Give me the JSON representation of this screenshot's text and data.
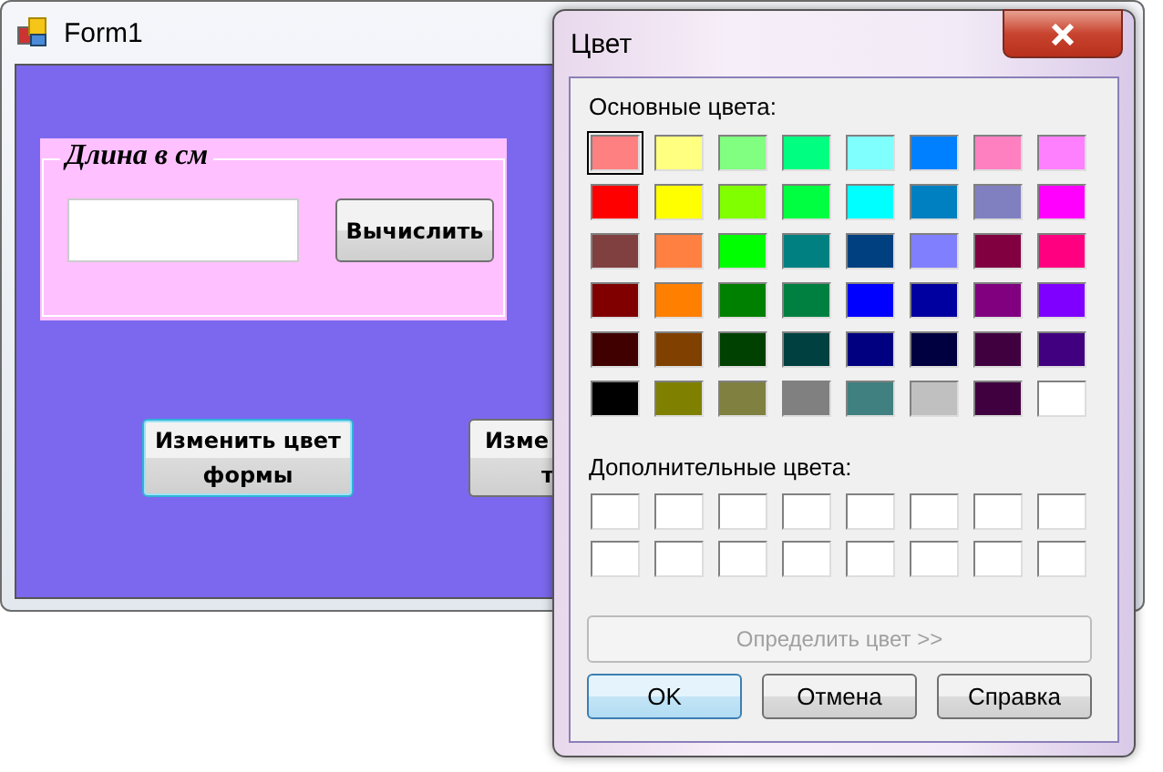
{
  "form_window": {
    "title": "Form1",
    "group": {
      "title": "Длина в см",
      "button": "Вычислить"
    },
    "buttons": [
      {
        "lines": [
          "Изменить цвет",
          "формы"
        ],
        "focused": true
      },
      {
        "lines": [
          "Изме",
          "т"
        ],
        "focused": false
      }
    ]
  },
  "color_dialog": {
    "title": "Цвет",
    "basic_label": "Основные цвета:",
    "basic_colors": [
      {
        "color": "#ff8080",
        "selected": true
      },
      {
        "color": "#ffff80",
        "selected": false
      },
      {
        "color": "#80ff80",
        "selected": false
      },
      {
        "color": "#00ff80",
        "selected": false
      },
      {
        "color": "#80ffff",
        "selected": false
      },
      {
        "color": "#0080ff",
        "selected": false
      },
      {
        "color": "#ff80c0",
        "selected": false
      },
      {
        "color": "#ff80ff",
        "selected": false
      },
      {
        "color": "#ff0000",
        "selected": false
      },
      {
        "color": "#ffff00",
        "selected": false
      },
      {
        "color": "#80ff00",
        "selected": false
      },
      {
        "color": "#00ff40",
        "selected": false
      },
      {
        "color": "#00ffff",
        "selected": false
      },
      {
        "color": "#0080c0",
        "selected": false
      },
      {
        "color": "#8080c0",
        "selected": false
      },
      {
        "color": "#ff00ff",
        "selected": false
      },
      {
        "color": "#804040",
        "selected": false
      },
      {
        "color": "#ff8040",
        "selected": false
      },
      {
        "color": "#00ff00",
        "selected": false
      },
      {
        "color": "#008080",
        "selected": false
      },
      {
        "color": "#004080",
        "selected": false
      },
      {
        "color": "#8080ff",
        "selected": false
      },
      {
        "color": "#800040",
        "selected": false
      },
      {
        "color": "#ff0080",
        "selected": false
      },
      {
        "color": "#800000",
        "selected": false
      },
      {
        "color": "#ff8000",
        "selected": false
      },
      {
        "color": "#008000",
        "selected": false
      },
      {
        "color": "#008040",
        "selected": false
      },
      {
        "color": "#0000ff",
        "selected": false
      },
      {
        "color": "#0000a0",
        "selected": false
      },
      {
        "color": "#800080",
        "selected": false
      },
      {
        "color": "#8000ff",
        "selected": false
      },
      {
        "color": "#400000",
        "selected": false
      },
      {
        "color": "#804000",
        "selected": false
      },
      {
        "color": "#004000",
        "selected": false
      },
      {
        "color": "#004040",
        "selected": false
      },
      {
        "color": "#000080",
        "selected": false
      },
      {
        "color": "#000040",
        "selected": false
      },
      {
        "color": "#400040",
        "selected": false
      },
      {
        "color": "#400080",
        "selected": false
      },
      {
        "color": "#000000",
        "selected": false
      },
      {
        "color": "#808000",
        "selected": false
      },
      {
        "color": "#808040",
        "selected": false
      },
      {
        "color": "#808080",
        "selected": false
      },
      {
        "color": "#408080",
        "selected": false
      },
      {
        "color": "#c0c0c0",
        "selected": false
      },
      {
        "color": "#400040",
        "selected": false
      },
      {
        "color": "#ffffff",
        "selected": false
      }
    ],
    "custom_label": "Дополнительные цвета:",
    "custom_colors": [
      {
        "color": "#ffffff"
      },
      {
        "color": "#ffffff"
      },
      {
        "color": "#ffffff"
      },
      {
        "color": "#ffffff"
      },
      {
        "color": "#ffffff"
      },
      {
        "color": "#ffffff"
      },
      {
        "color": "#ffffff"
      },
      {
        "color": "#ffffff"
      },
      {
        "color": "#ffffff"
      },
      {
        "color": "#ffffff"
      },
      {
        "color": "#ffffff"
      },
      {
        "color": "#ffffff"
      },
      {
        "color": "#ffffff"
      },
      {
        "color": "#ffffff"
      },
      {
        "color": "#ffffff"
      },
      {
        "color": "#ffffff"
      }
    ],
    "define_button": {
      "label": "Определить цвет >>",
      "disabled": true
    },
    "buttons": [
      {
        "label": "OK",
        "default": true
      },
      {
        "label": "Отмена",
        "default": false
      },
      {
        "label": "Справка",
        "default": false
      }
    ]
  }
}
